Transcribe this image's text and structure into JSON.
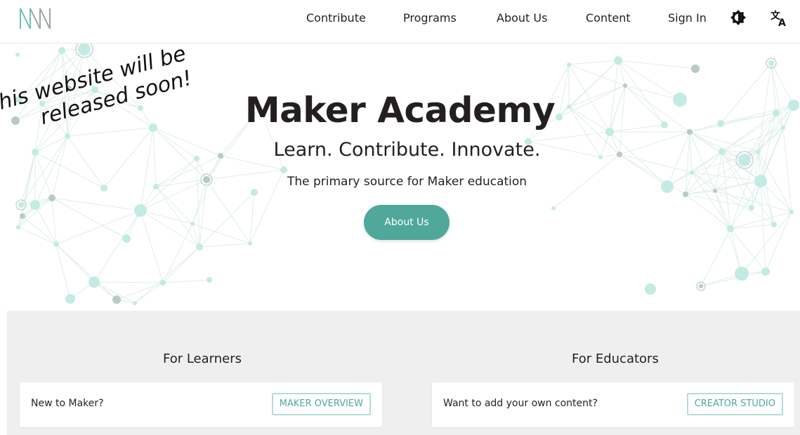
{
  "brand": {
    "logo_icon": "maker-m-logo-icon",
    "accent_color": "#4fa89a",
    "accent_light": "#b5dcd5",
    "node_color": "#b8e6dc"
  },
  "nav": {
    "items": [
      {
        "label": "Contribute"
      },
      {
        "label": "Programs"
      },
      {
        "label": "About Us"
      },
      {
        "label": "Content"
      },
      {
        "label": "Sign In"
      }
    ],
    "theme_icon": "theme-toggle-icon",
    "language_icon": "translate-icon"
  },
  "hero": {
    "title": "Maker Academy",
    "subtitle": "Learn. Contribute. Innovate.",
    "tagline": "The primary source for Maker education",
    "button_label": "About Us",
    "overlay_line1": "his website will be",
    "overlay_line2": "released soon!"
  },
  "sections": [
    {
      "title": "For Learners",
      "card_text": "New to Maker?",
      "button_label": "MAKER OVERVIEW"
    },
    {
      "title": "For Educators",
      "card_text": "Want to add your own content?",
      "button_label": "CREATOR STUDIO"
    }
  ]
}
